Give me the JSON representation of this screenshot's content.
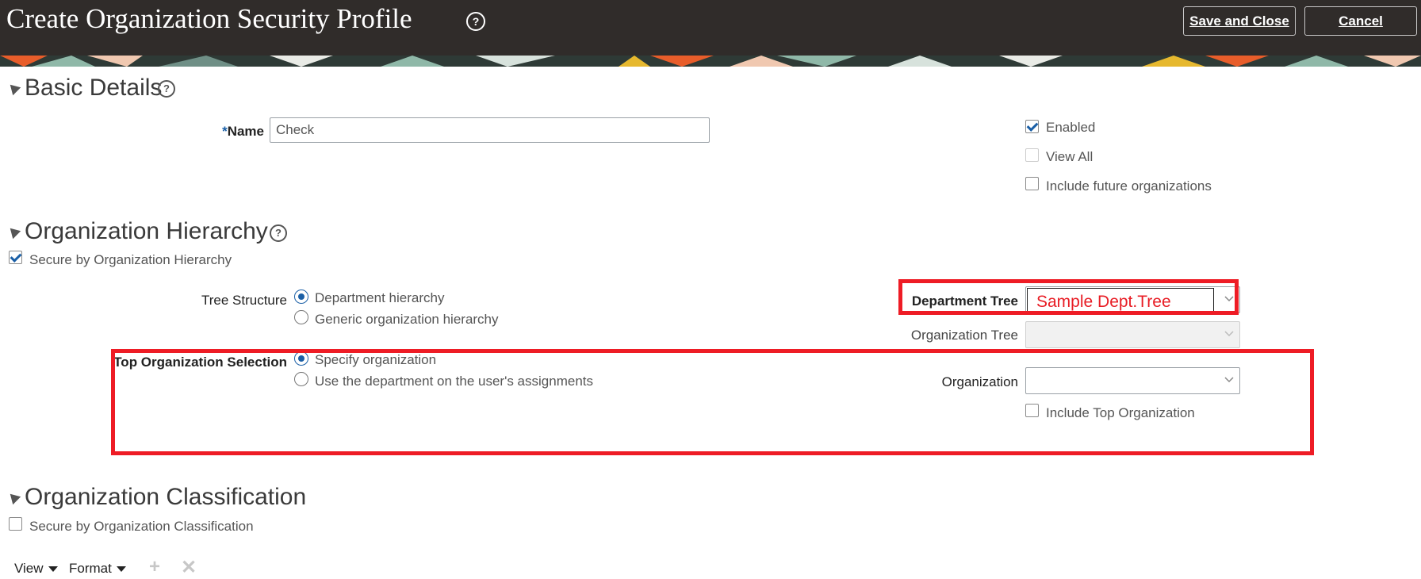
{
  "header": {
    "title": "Create Organization Security Profile",
    "help_icon": "help-circle-icon",
    "save_and_close": "Save and Close",
    "cancel": "Cancel"
  },
  "basic_details": {
    "title": "Basic Details",
    "name_required_marker": "*",
    "name_label": "Name",
    "name_value": "Check",
    "enabled_label": "Enabled",
    "enabled_checked": true,
    "view_all_label": "View All",
    "include_future_label": "Include future organizations"
  },
  "org_hierarchy": {
    "title": "Organization Hierarchy",
    "secure_label": "Secure by Organization Hierarchy",
    "tree_structure_label": "Tree Structure",
    "tree_options": [
      "Department hierarchy",
      "Generic organization hierarchy"
    ],
    "tree_selected": "Department hierarchy",
    "department_tree_label": "Department Tree",
    "department_tree_value": "Sample Dept.Tree",
    "organization_tree_label": "Organization Tree",
    "top_org_label": "Top Organization Selection",
    "top_org_options": [
      "Specify organization",
      "Use the department on the user's assignments"
    ],
    "top_org_selected": "Specify organization",
    "organization_label": "Organization",
    "include_top_label": "Include Top Organization"
  },
  "org_classification": {
    "title": "Organization Classification",
    "secure_label": "Secure by Organization Classification"
  },
  "toolbar": {
    "view": "View",
    "format": "Format",
    "add_icon": "plus-icon",
    "delete_icon": "x-icon"
  },
  "colors": {
    "header_bg": "#302c2a",
    "accent": "#1a5fa6",
    "annotation_red": "#ee1c25"
  }
}
